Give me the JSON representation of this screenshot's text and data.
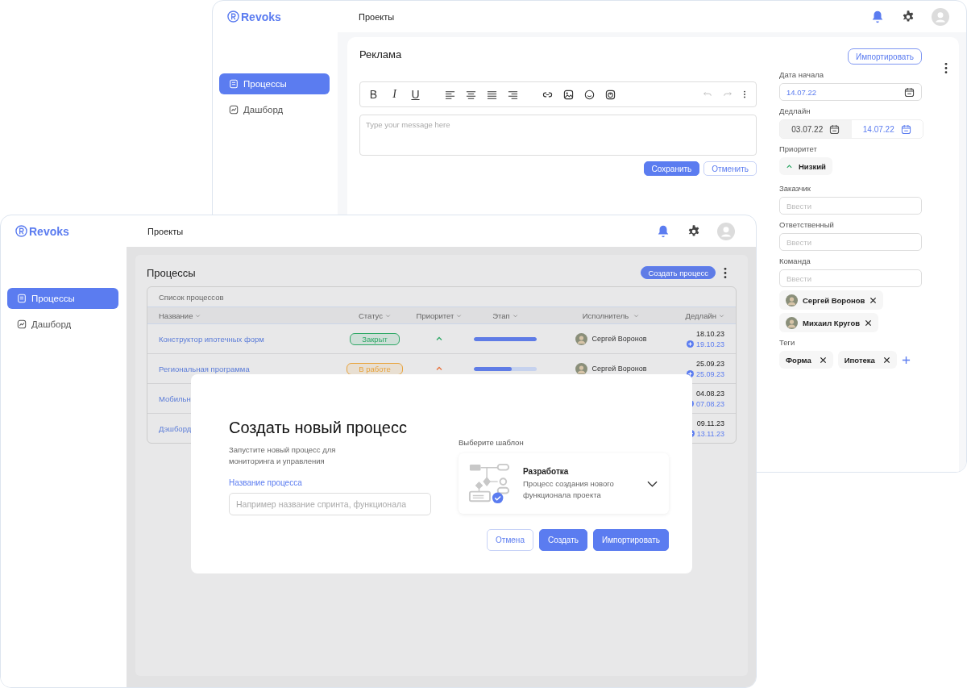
{
  "back_window": {
    "logo": "Revoks",
    "header_title": "Проекты",
    "sidebar": [
      {
        "label": "Процессы",
        "selected": true
      },
      {
        "label": "Дашборд",
        "selected": false
      }
    ],
    "page_title": "Реклама",
    "import_button": "Импортировать",
    "editor": {
      "format_buttons": [
        "B",
        "I",
        "U"
      ],
      "placeholder": "Type your message here",
      "save_button": "Сохранить",
      "cancel_button": "Отменить"
    },
    "details": {
      "start_date": {
        "label": "Дата начала",
        "value": "14.07.22"
      },
      "deadline": {
        "label": "Дедлайн",
        "from": "03.07.22",
        "to": "14.07.22"
      },
      "priority": {
        "label": "Приоритет",
        "value": "Низкий",
        "kind": "low"
      },
      "inputs": [
        {
          "label": "Заказчик",
          "placeholder": "Ввести"
        },
        {
          "label": "Ответственный",
          "placeholder": "Ввести"
        },
        {
          "label": "Команда",
          "placeholder": "Ввести"
        }
      ],
      "team": [
        "Сергей Воронов",
        "Михаил Кругов"
      ],
      "tags_label": "Теги",
      "tags": [
        "Форма",
        "Ипотека"
      ]
    }
  },
  "front_window": {
    "logo": "Revoks",
    "header_title": "Проекты",
    "sidebar": [
      {
        "label": "Процессы",
        "selected": true
      },
      {
        "label": "Дашборд",
        "selected": false
      }
    ],
    "page_title": "Процессы",
    "create_button": "Создать процесс",
    "table": {
      "title": "Список процессов",
      "columns": [
        "Название",
        "Статус",
        "Приоритет",
        "Этап",
        "Исполнитель",
        "Дедлайн"
      ],
      "rows": [
        {
          "name": "Конструктор ипотечных форм",
          "status": {
            "label": "Закрыт",
            "color": "#2ea866"
          },
          "priority": {
            "kind": "low"
          },
          "level": 1,
          "assignee": "Сергей Воронов",
          "deadline": "18.10.23",
          "new_deadline": "19.10.23"
        },
        {
          "name": "Региональная программа",
          "status": {
            "label": "В работе",
            "color": "#e8a33c"
          },
          "priority": {
            "kind": "high"
          },
          "level": 0.6,
          "assignee": "Сергей Воронов",
          "deadline": "25.09.23",
          "new_deadline": "25.09.23"
        },
        {
          "name": "Мобильн",
          "deadline": "04.08.23",
          "new_deadline": "07.08.23"
        },
        {
          "name": "Дэшборд",
          "deadline": "09.11.23",
          "new_deadline": "13.11.23"
        }
      ]
    }
  },
  "modal": {
    "title": "Создать новый процесс",
    "subtitle": "Запустите новый процесс для мониторинга и управления",
    "field_label": "Название процесса",
    "field_placeholder": "Например название спринта, функционала",
    "template_label": "Выберите шаблон",
    "template": {
      "name": "Разработка",
      "description": "Процесс создания нового функционала проекта"
    },
    "buttons": [
      {
        "label": "Отмена",
        "kind": "secondary"
      },
      {
        "label": "Создать",
        "kind": "primary"
      },
      {
        "label": "Импортировать",
        "kind": "primary"
      }
    ]
  }
}
